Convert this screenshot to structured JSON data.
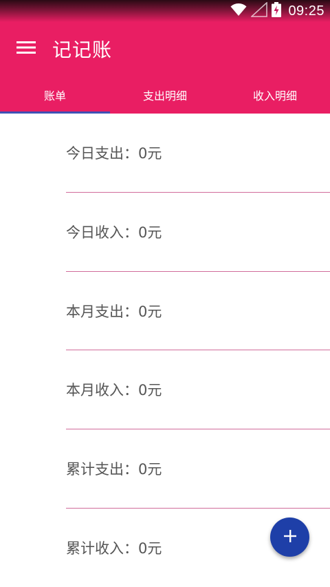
{
  "status_bar": {
    "time": "09:25",
    "icons": [
      "wifi-icon",
      "signal-icon",
      "battery-charging-icon"
    ]
  },
  "toolbar": {
    "menu_icon": "menu-icon",
    "title": "记记账"
  },
  "tabs": [
    {
      "label": "账单",
      "active": true
    },
    {
      "label": "支出明细",
      "active": false
    },
    {
      "label": "收入明细",
      "active": false
    }
  ],
  "summary": [
    {
      "label": "今日支出：0元"
    },
    {
      "label": "今日收入：0元"
    },
    {
      "label": "本月支出：0元"
    },
    {
      "label": "本月收入：0元"
    },
    {
      "label": "累计支出：0元"
    },
    {
      "label": "累计收入：0元"
    }
  ],
  "fab": {
    "icon": "plus-icon"
  },
  "colors": {
    "primary": "#e91e63",
    "tab_indicator": "#3f51b5",
    "fab": "#1e3fa8",
    "divider": "#d06b9a"
  }
}
